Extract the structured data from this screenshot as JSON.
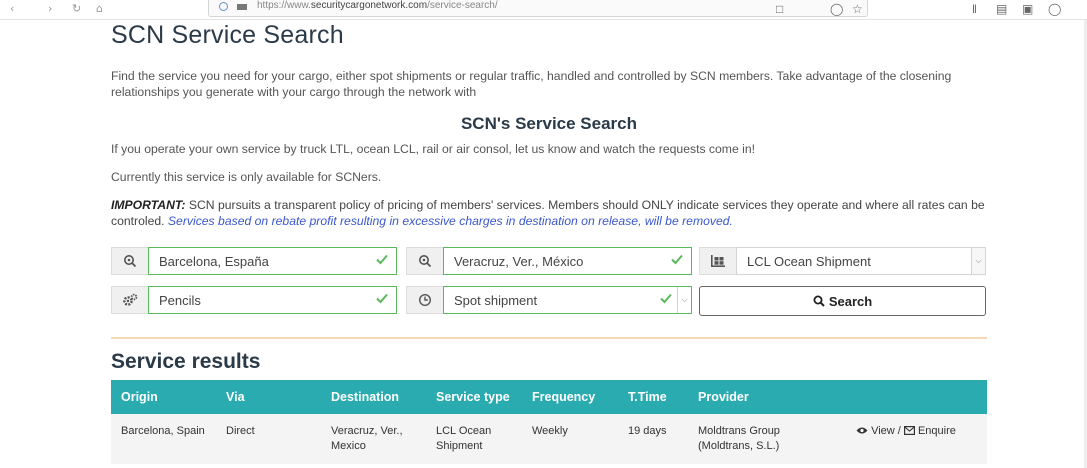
{
  "browser": {
    "url_prefix": "https://www.",
    "url_domain": "securitycargonetwork.com",
    "url_path": "/service-search/"
  },
  "page": {
    "title": "SCN Service Search",
    "intro": "Find the service you need for your cargo, either spot shipments or regular traffic, handled and controlled by SCN members. Take advantage of the closening relationships you generate with your cargo through the network with",
    "subtitle": "SCN's Service Search",
    "operate_note": "If you operate your own service by truck LTL, ocean LCL, rail or air consol, let us know and watch the requests come in!",
    "availability_note": "Currently this service is only available for SCNers.",
    "important_label": "IMPORTANT:",
    "important_text": " SCN pursuits a transparent policy of pricing of members' services. Members should ONLY indicate services they operate and where all rates can be controled. ",
    "important_link": "Services based on rebate profit resulting in excessive charges in destination on release, will be removed."
  },
  "form": {
    "origin": "Barcelona, España",
    "destination": "Veracruz, Ver., México",
    "service_type": "LCL Ocean Shipment",
    "commodity": "Pencils",
    "frequency": "Spot shipment",
    "search_label": "Search"
  },
  "results": {
    "title": "Service results",
    "columns": [
      "Origin",
      "Via",
      "Destination",
      "Service type",
      "Frequency",
      "T.Time",
      "Provider",
      ""
    ],
    "rows": [
      {
        "origin": "Barcelona, Spain",
        "via": "Direct",
        "destination": "Veracruz, Ver., Mexico",
        "service_type": "LCL Ocean Shipment",
        "frequency": "Weekly",
        "ttime": "19 days",
        "provider": "Moldtrans Group (Moldtrans, S.L.)",
        "view_label": "View",
        "separator": " / ",
        "enquire_label": "Enquire"
      }
    ]
  },
  "colors": {
    "table_header": "#2aabb0",
    "valid_border": "#5cb85c",
    "link": "#3a57c9"
  }
}
